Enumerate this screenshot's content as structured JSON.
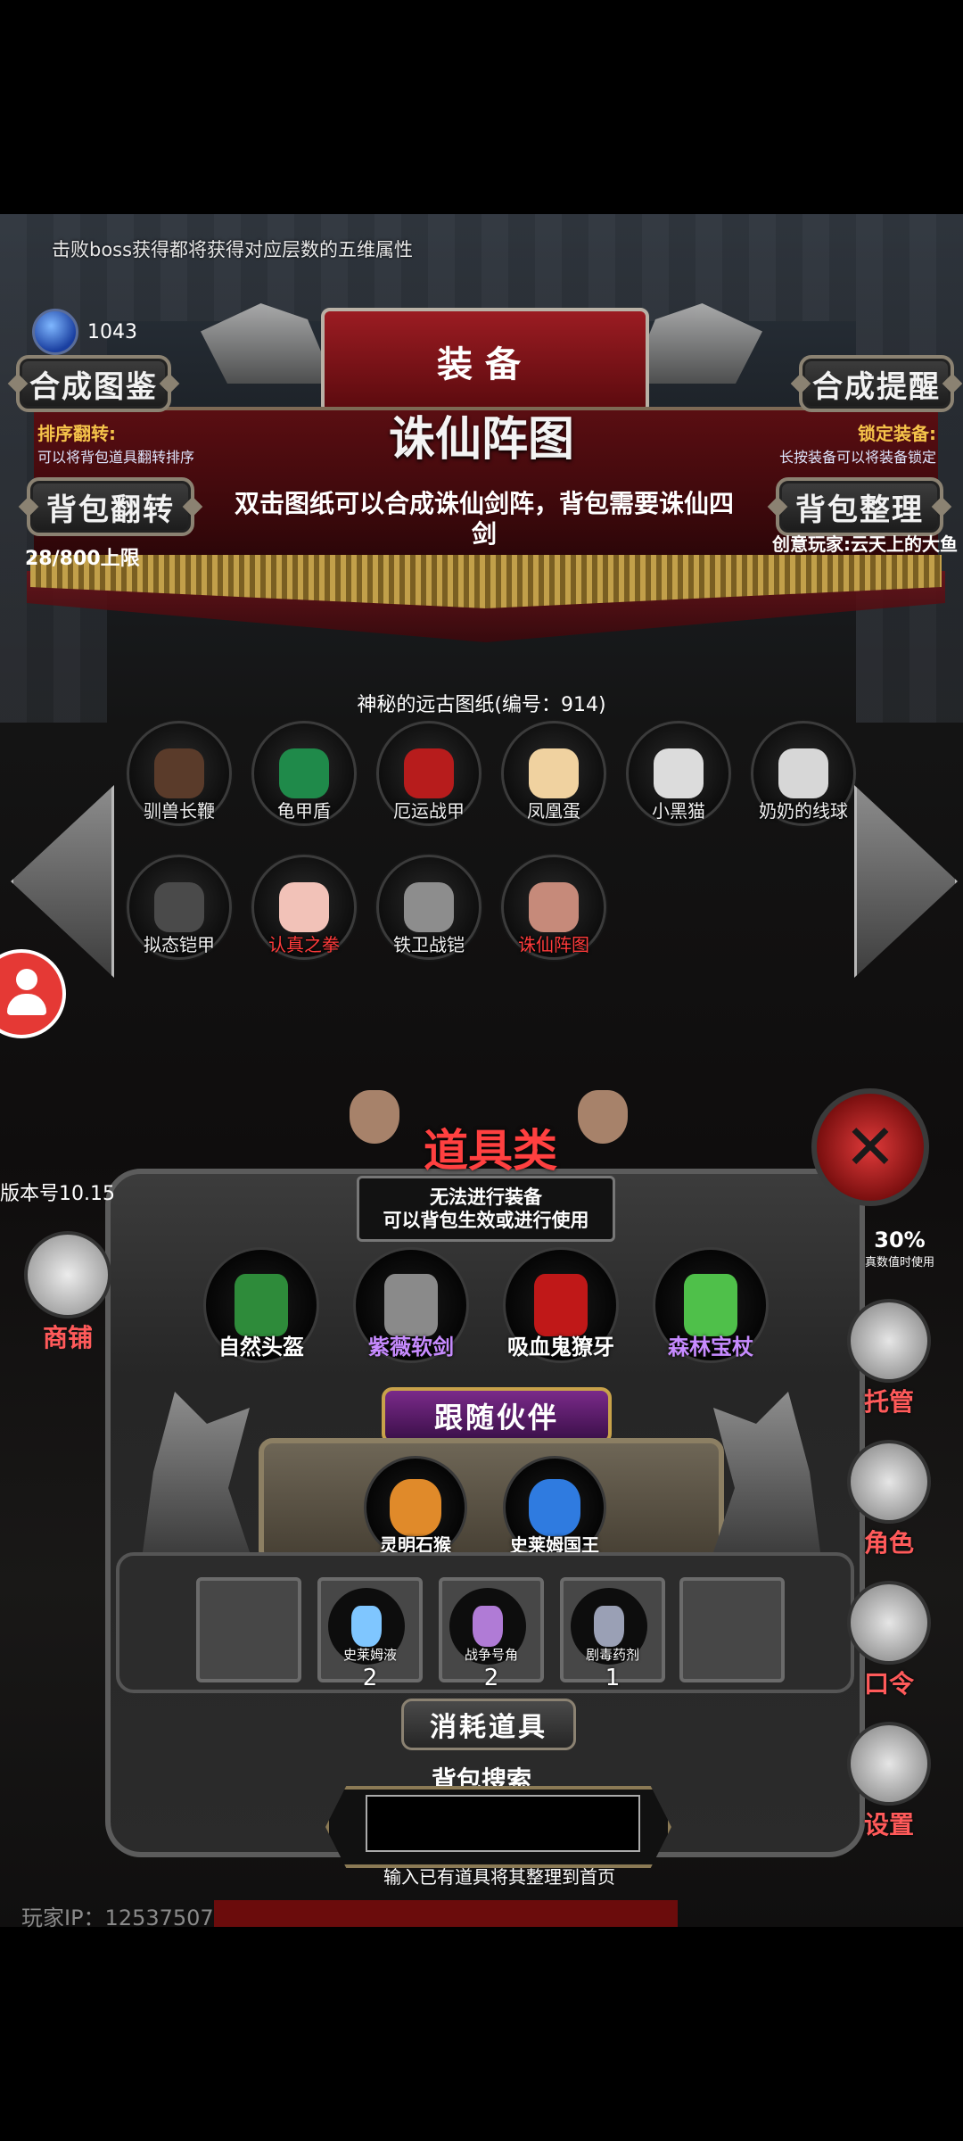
{
  "top_tip": "击败boss获得都将获得对应层数的五维属性",
  "currency": {
    "value": "1043",
    "icon": "blue-crystal"
  },
  "buttons": {
    "atlas": "合成图鉴",
    "remind": "合成提醒",
    "flip": "背包翻转",
    "sort": "背包整理"
  },
  "header_title": "装备",
  "flip_hint": {
    "title": "排序翻转:",
    "desc": "可以将背包道具翻转排序"
  },
  "lock_hint": {
    "title": "锁定装备:",
    "desc": "长按装备可以将装备锁定"
  },
  "selected_item": {
    "name": "诛仙阵图",
    "desc": "双击图纸可以合成诛仙剑阵，背包需要诛仙四剑"
  },
  "capacity": "28/800上限",
  "creator": "创意玩家:云天上的大鱼",
  "blueprint_title": "神秘的远古图纸(编号：914)",
  "items": [
    {
      "name": "驯兽长鞭",
      "red": false,
      "icon": "whip"
    },
    {
      "name": "龟甲盾",
      "red": false,
      "icon": "turtle-shield"
    },
    {
      "name": "厄运战甲",
      "red": false,
      "icon": "doom-armor"
    },
    {
      "name": "凤凰蛋",
      "red": false,
      "icon": "phoenix-egg"
    },
    {
      "name": "小黑猫",
      "red": false,
      "icon": "black-cat"
    },
    {
      "name": "奶奶的线球",
      "red": false,
      "icon": "yarn-ball"
    },
    {
      "name": "拟态铠甲",
      "red": false,
      "icon": "mimic-armor"
    },
    {
      "name": "认真之拳",
      "red": true,
      "icon": "fist"
    },
    {
      "name": "铁卫战铠",
      "red": false,
      "icon": "iron-armor"
    },
    {
      "name": "诛仙阵图",
      "red": true,
      "icon": "formation-map"
    }
  ],
  "version": "版本号10.15",
  "category": {
    "title": "道具类",
    "line1": "无法进行装备",
    "line2": "可以背包生效或进行使用"
  },
  "shop_label": "商铺",
  "equipped": [
    {
      "name": "自然头盔",
      "color": "#ffffff",
      "icon": "nature-helmet"
    },
    {
      "name": "紫薇软剑",
      "color": "#c78bff",
      "icon": "purple-sword"
    },
    {
      "name": "吸血鬼獠牙",
      "color": "#ffffff",
      "icon": "vampire-fang"
    },
    {
      "name": "森林宝杖",
      "color": "#c78bff",
      "icon": "forest-staff"
    }
  ],
  "partner_title": "跟随伙伴",
  "partners": [
    {
      "name": "灵明石猴",
      "icon": "stone-monkey"
    },
    {
      "name": "史莱姆国王",
      "icon": "slime-king"
    }
  ],
  "consumables": [
    {
      "name": "史莱姆液",
      "count": "2",
      "icon": "slime-potion"
    },
    {
      "name": "战争号角",
      "count": "2",
      "icon": "war-horn"
    },
    {
      "name": "剧毒药剂",
      "count": "1",
      "icon": "poison-potion"
    }
  ],
  "consumables_title": "消耗道具",
  "search": {
    "title": "背包搜索",
    "placeholder": "",
    "hint": "输入已有道具将其整理到首页"
  },
  "player_id": "玩家IP：12537507",
  "right_menu": [
    {
      "label": "托管",
      "icon": "dice-icon"
    },
    {
      "label": "角色",
      "icon": "character-icon"
    },
    {
      "label": "口令",
      "icon": "book-icon"
    },
    {
      "label": "设置",
      "icon": "gear-icon"
    }
  ],
  "value_badge": {
    "value": "30%",
    "label": "真数值时使用"
  }
}
